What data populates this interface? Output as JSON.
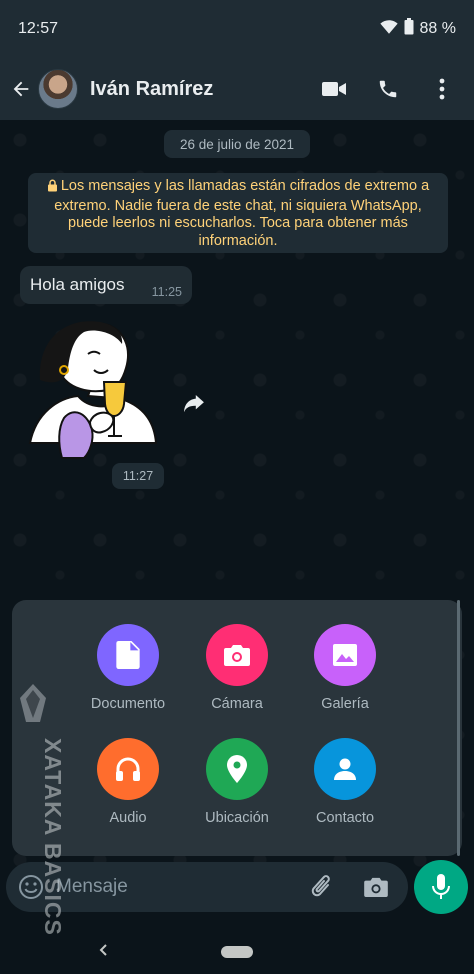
{
  "status_bar": {
    "time": "12:57",
    "battery": "88 %"
  },
  "header": {
    "contact_name": "Iván Ramírez"
  },
  "chat": {
    "date_chip": "26 de julio de 2021",
    "encryption_notice": "Los mensajes y las llamadas están cifrados de extremo a extremo. Nadie fuera de este chat, ni siquiera WhatsApp, puede leerlos ni escucharlos. Toca para obtener más información.",
    "messages": [
      {
        "text": "Hola amigos",
        "time": "11:25"
      }
    ],
    "sticker_time": "11:27"
  },
  "attach_menu": {
    "items": [
      {
        "label": "Documento",
        "icon": "document-icon",
        "color": "#7f66ff"
      },
      {
        "label": "Cámara",
        "icon": "camera-icon",
        "color": "#ff2e74"
      },
      {
        "label": "Galería",
        "icon": "gallery-icon",
        "color": "#c861fa"
      },
      {
        "label": "Audio",
        "icon": "headphones-icon",
        "color": "#ff6d2d"
      },
      {
        "label": "Ubicación",
        "icon": "location-icon",
        "color": "#1fa855"
      },
      {
        "label": "Contacto",
        "icon": "contact-icon",
        "color": "#0795dc"
      }
    ]
  },
  "composer": {
    "placeholder": "Mensaje"
  },
  "watermark": {
    "text": "XATAKA BASICS"
  },
  "colors": {
    "accent": "#00a884",
    "header_bg": "#1f2c34",
    "chat_bg": "#0b141a"
  }
}
